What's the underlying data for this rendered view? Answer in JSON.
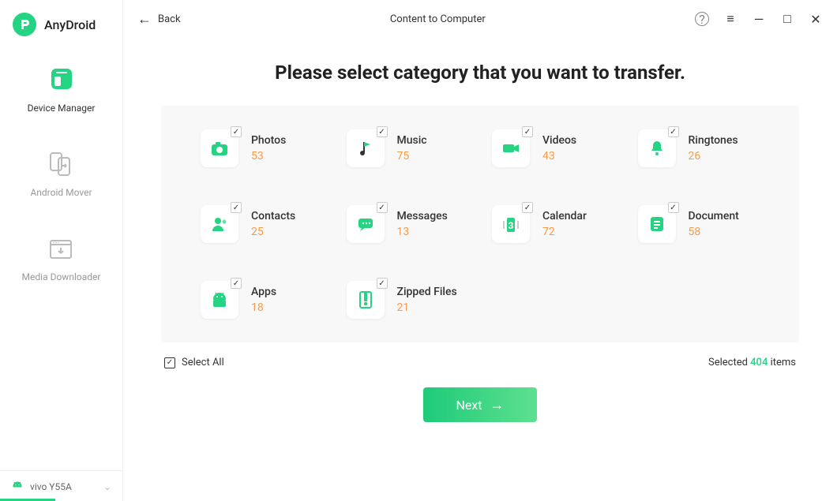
{
  "app": {
    "name": "AnyDroid"
  },
  "sidebar": {
    "items": [
      {
        "label": "Device Manager"
      },
      {
        "label": "Android Mover"
      },
      {
        "label": "Media Downloader"
      }
    ],
    "device": {
      "name": "vivo Y55A"
    }
  },
  "header": {
    "back": "Back",
    "title": "Content to Computer"
  },
  "main": {
    "heading": "Please select category that you want to transfer."
  },
  "categories": [
    {
      "label": "Photos",
      "count": "53"
    },
    {
      "label": "Music",
      "count": "75"
    },
    {
      "label": "Videos",
      "count": "43"
    },
    {
      "label": "Ringtones",
      "count": "26"
    },
    {
      "label": "Contacts",
      "count": "25"
    },
    {
      "label": "Messages",
      "count": "13"
    },
    {
      "label": "Calendar",
      "count": "72"
    },
    {
      "label": "Document",
      "count": "58"
    },
    {
      "label": "Apps",
      "count": "18"
    },
    {
      "label": "Zipped Files",
      "count": "21"
    }
  ],
  "footer": {
    "select_all": "Select All",
    "selected_prefix": "Selected ",
    "selected_count": "404",
    "selected_suffix": " items",
    "next": "Next"
  }
}
